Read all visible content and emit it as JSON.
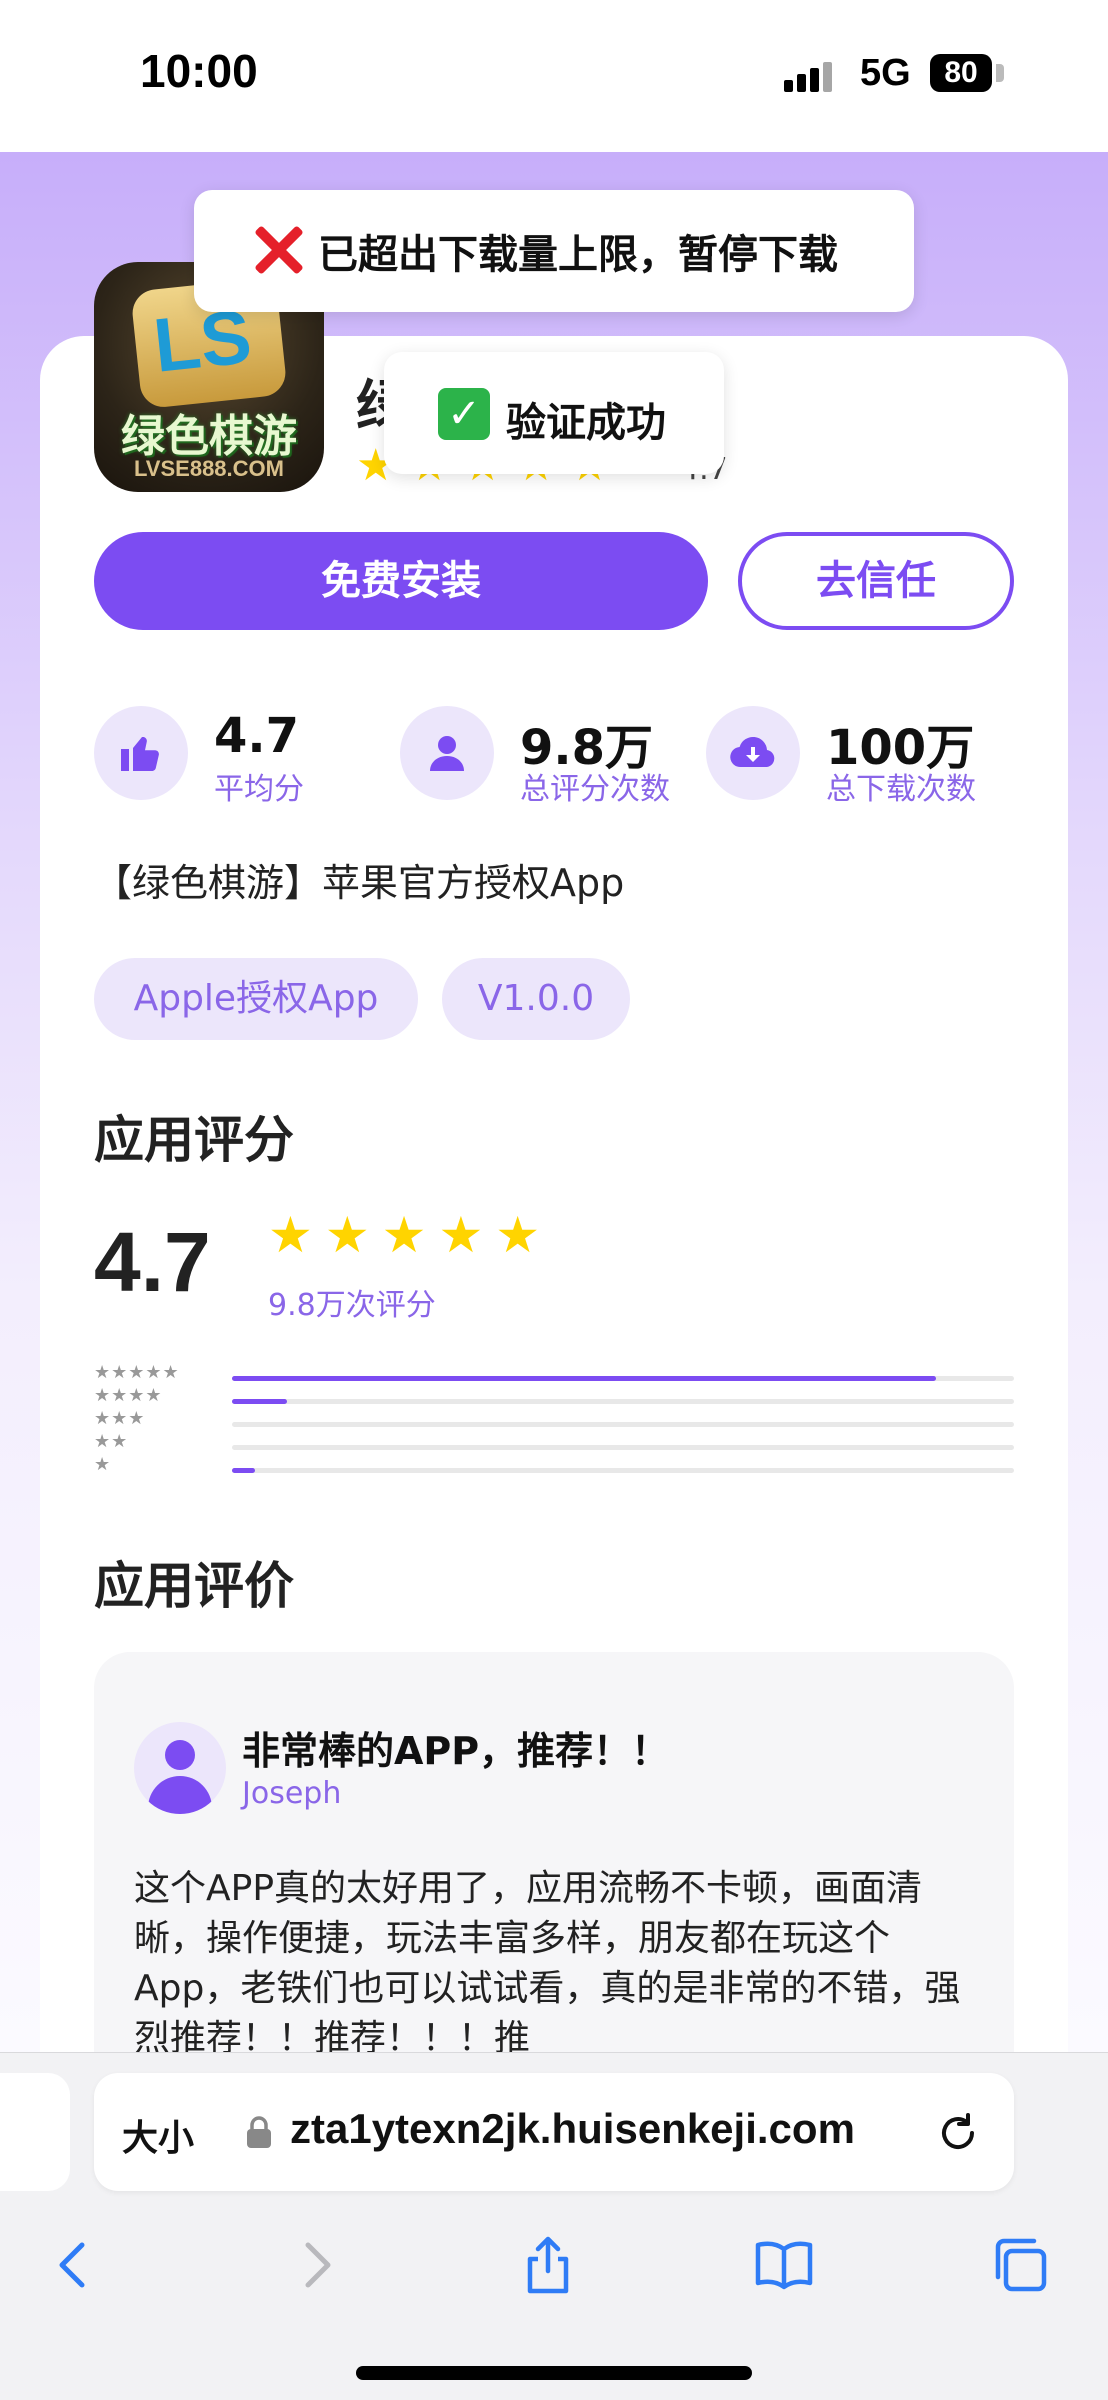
{
  "status_bar": {
    "time": "10:00",
    "network": "5G",
    "battery": "80"
  },
  "toast_error": {
    "message": "已超出下载量上限，暂停下载"
  },
  "toast_success": {
    "message": "验证成功"
  },
  "app": {
    "icon_name_text": "绿色棋游",
    "icon_url_text": "LVSE888.COM",
    "title_partial": "绿",
    "title_stars": "★★★★★",
    "title_rating_partial": "4.7"
  },
  "actions": {
    "install_label": "免费安装",
    "trust_label": "去信任"
  },
  "stats": [
    {
      "icon": "thumbs-up-icon",
      "value": "4.7",
      "label": "平均分"
    },
    {
      "icon": "user-icon",
      "value": "9.8万",
      "label": "总评分次数"
    },
    {
      "icon": "cloud-download-icon",
      "value": "100万",
      "label": "总下载次数"
    }
  ],
  "description": "【绿色棋游】苹果官方授权App",
  "tags": [
    "Apple授权App",
    "V1.0.0"
  ],
  "rating_section": {
    "title": "应用评分",
    "score": "4.7",
    "stars": "★★★★★",
    "count_label": "9.8万次评分",
    "histogram": [
      {
        "stars": "★★★★★",
        "fraction": 0.9
      },
      {
        "stars": "★★★★",
        "fraction": 0.07
      },
      {
        "stars": "★★★",
        "fraction": 0
      },
      {
        "stars": "★★",
        "fraction": 0
      },
      {
        "stars": "★",
        "fraction": 0.03
      }
    ]
  },
  "reviews_section": {
    "title": "应用评价",
    "reviews": [
      {
        "title": "非常棒的APP，推荐！！",
        "author": "Joseph",
        "text": "这个APP真的太好用了，应用流畅不卡顿，画面清晰，操作便捷，玩法丰富多样，朋友都在玩这个App，老铁们也可以试试看，真的是非常的不错，强烈推荐！！推荐！！！推"
      }
    ]
  },
  "browser": {
    "size_button": "大小",
    "url": "zta1ytexn2jk.huisenkeji.com"
  },
  "colors": {
    "accent": "#7c4cf2",
    "accent_light": "#ece6fb",
    "star": "#ffd400",
    "error": "#e5202a",
    "success": "#2cb34a"
  }
}
